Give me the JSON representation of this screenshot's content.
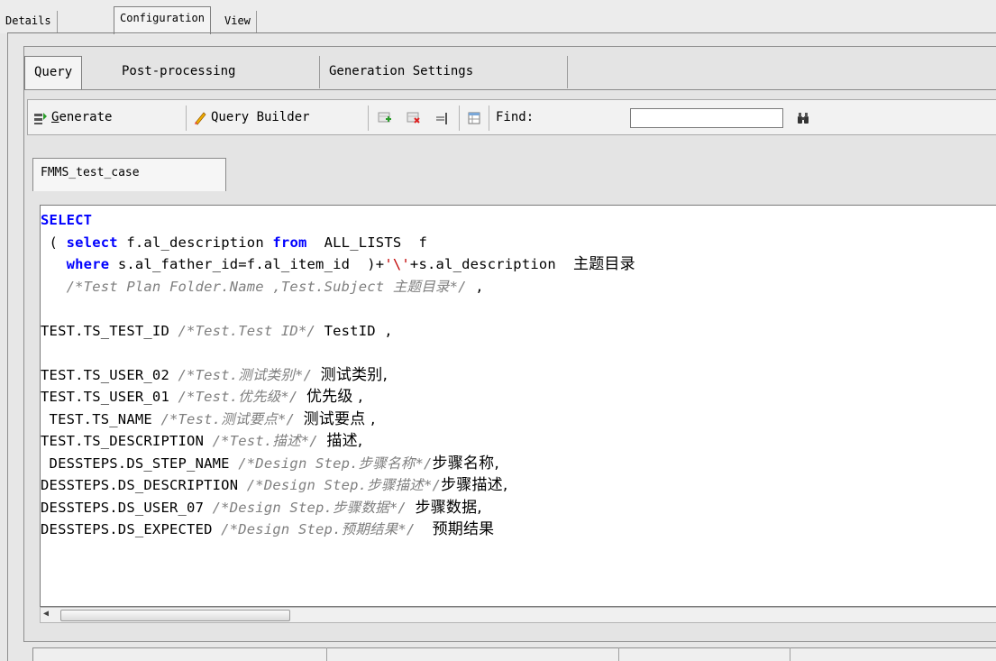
{
  "top_tabs": [
    {
      "label": "Details"
    },
    {
      "label": "Configuration"
    },
    {
      "label": "View"
    }
  ],
  "sub_tabs": [
    {
      "label": "Query"
    },
    {
      "label": "Post-processing"
    },
    {
      "label": "Generation Settings"
    }
  ],
  "toolbar": {
    "generate_label_mnemonic": "G",
    "generate_label_rest": "enerate",
    "query_builder_label": "Query Builder",
    "find_label": "Find:",
    "find_value": ""
  },
  "file_tab": {
    "label": "FMMS_test_case"
  },
  "code_lines": {
    "l1": "SELECT",
    "l2a": " ( ",
    "l2b": "select",
    "l2c": " f.al_description ",
    "l2d": "from",
    "l2e": "  ALL_LISTS  f",
    "l3a": "   ",
    "l3b": "where",
    "l3c": " s.al_father_id=f.al_item_id  )+",
    "l3d": "'\\'",
    "l3e": "+s.al_description  ",
    "l3f": "主题目录",
    "l4a": "   ",
    "l4b": "/*Test Plan Folder.Name ,Test.Subject 主题目录*/",
    "l4c": " ,",
    "l5": "",
    "l6a": "TEST.TS_TEST_ID ",
    "l6b": "/*Test.Test ID*/",
    "l6c": " TestID ,",
    "l7": "",
    "l8a": "TEST.TS_USER_02 ",
    "l8b": "/*Test.测试类别*/",
    "l8c": " ",
    "l8d": "测试类别,",
    "l9a": "TEST.TS_USER_01 ",
    "l9b": "/*Test.优先级*/",
    "l9c": " ",
    "l9d": "优先级 ,",
    "l10a": " TEST.TS_NAME ",
    "l10b": "/*Test.测试要点*/",
    "l10c": " ",
    "l10d": "测试要点 ,",
    "l11a": "TEST.TS_DESCRIPTION ",
    "l11b": "/*Test.描述*/",
    "l11c": " ",
    "l11d": "描述,",
    "l12a": " DESSTEPS.DS_STEP_NAME ",
    "l12b": "/*Design Step.步骤名称*/",
    "l12c": "步骤名称,",
    "l13a": "DESSTEPS.DS_DESCRIPTION ",
    "l13b": "/*Design Step.步骤描述*/",
    "l13c": "步骤描述,",
    "l14a": "DESSTEPS.DS_USER_07 ",
    "l14b": "/*Design Step.步骤数据*/",
    "l14c": " ",
    "l14d": "步骤数据,",
    "l15a": "DESSTEPS.DS_EXPECTED ",
    "l15b": "/*Design Step.预期结果*/",
    "l15c": "  ",
    "l15d": "预期结果"
  },
  "icons": [
    "generate-icon",
    "pencil-icon",
    "add-row-icon",
    "delete-row-icon",
    "insert-column-icon",
    "table-icon",
    "binoculars-icon",
    "scroll-left-arrow-icon"
  ],
  "colors": {
    "keyword": "#0000ff",
    "comment": "#7f7f7f",
    "string": "#c00000"
  }
}
